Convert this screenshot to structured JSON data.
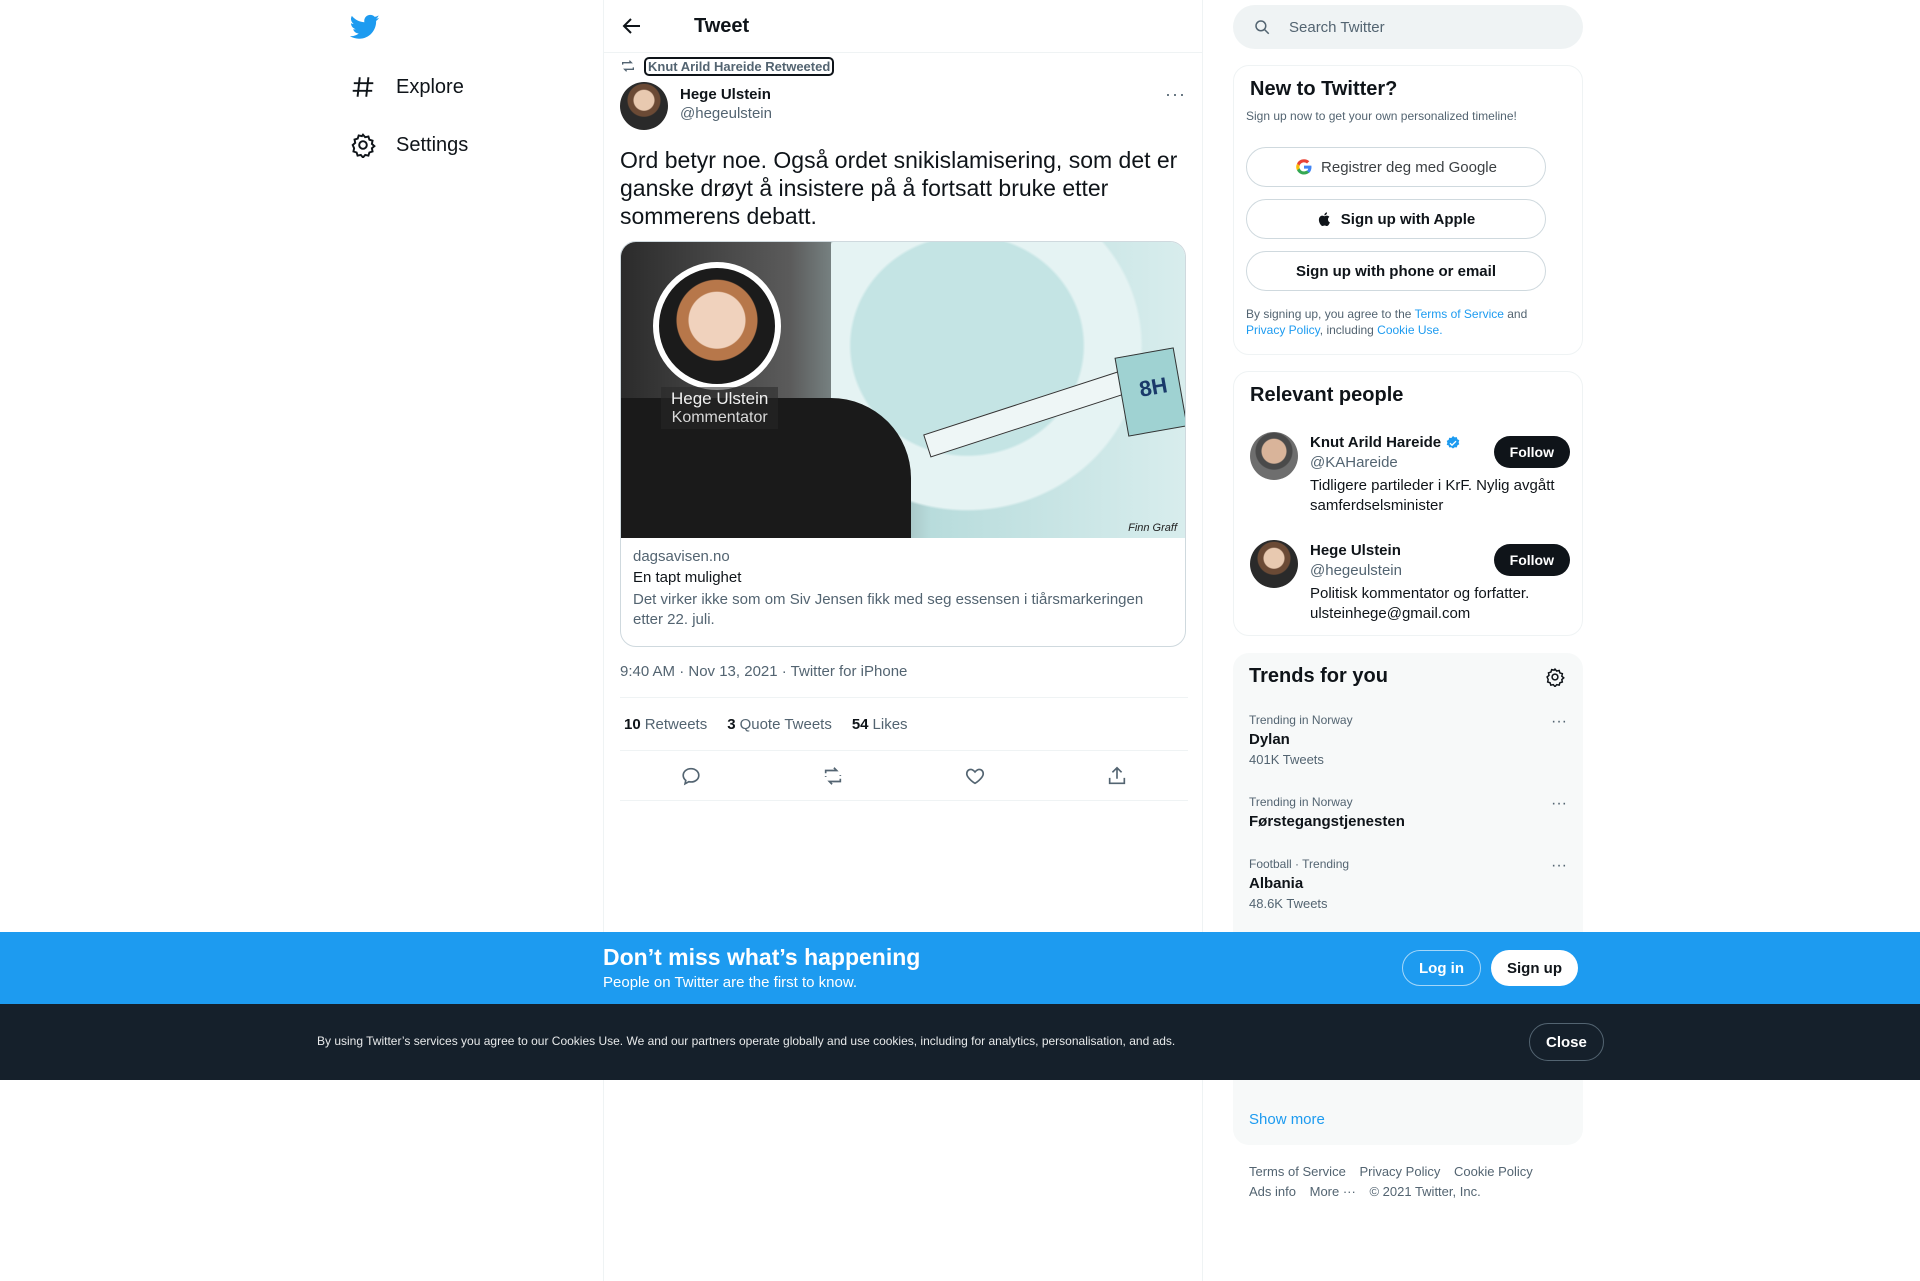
{
  "nav": {
    "explore_label": "Explore",
    "settings_label": "Settings"
  },
  "tweet_header": {
    "title": "Tweet"
  },
  "tweet": {
    "retweeted_by": "Knut Arild Hareide Retweeted",
    "author_name": "Hege Ulstein",
    "author_handle": "@hegeulstein",
    "more": "···",
    "text": "Ord betyr noe. Også ordet snikislamisering, som det er ganske drøyt å insistere på å fortsatt bruke etter sommerens debatt.",
    "card": {
      "image_caption_name": "Hege Ulstein",
      "image_caption_role": "Kommentator",
      "image_sleeve_text": "8H",
      "image_signature": "Finn Graff",
      "domain": "dagsavisen.no",
      "title": "En tapt mulighet",
      "description": "Det virker ikke som om Siv Jensen fikk med seg essensen i tiårsmarkeringen etter 22. juli."
    },
    "timestamp": "9:40 AM · Nov 13, 2021 · Twitter for iPhone",
    "stats": {
      "retweets_count": "10",
      "retweets_label": "Retweets",
      "quotes_count": "3",
      "quotes_label": "Quote Tweets",
      "likes_count": "54",
      "likes_label": "Likes"
    }
  },
  "search": {
    "placeholder": "Search Twitter"
  },
  "new_to_twitter": {
    "title": "New to Twitter?",
    "subtitle": "Sign up now to get your own personalized timeline!",
    "google_label": "Registrer deg med Google",
    "apple_label": "Sign up with Apple",
    "phone_label": "Sign up with phone or email",
    "legal_prefix": "By signing up, you agree to the ",
    "terms": "Terms of Service",
    "and": " and ",
    "privacy": "Privacy Policy",
    "including": ", including ",
    "cookie_use": "Cookie Use."
  },
  "relevant_people": {
    "title": "Relevant people",
    "people": [
      {
        "name": "Knut Arild Hareide",
        "handle": "@KAHareide",
        "bio": "Tidligere partileder i KrF. Nylig avgått samferdselsminister",
        "follow": "Follow",
        "verified": true
      },
      {
        "name": "Hege Ulstein",
        "handle": "@hegeulstein",
        "bio": "Politisk kommentator og forfatter. ulsteinhege@gmail.com",
        "follow": "Follow",
        "verified": false
      }
    ]
  },
  "trends": {
    "title": "Trends for you",
    "items": [
      {
        "context": "Trending in Norway",
        "name": "Dylan",
        "count": "401K Tweets"
      },
      {
        "context": "Trending in Norway",
        "name": "Førstegangstjenesten",
        "count": ""
      },
      {
        "context": "Football · Trending",
        "name": "Albania",
        "count": "48.6K Tweets"
      }
    ],
    "show_more": "Show more"
  },
  "footer": {
    "terms": "Terms of Service",
    "privacy": "Privacy Policy",
    "cookie": "Cookie Policy",
    "ads": "Ads info",
    "more": "More ···",
    "copyright": "© 2021 Twitter, Inc."
  },
  "promo": {
    "title": "Don’t miss what’s happening",
    "subtitle": "People on Twitter are the first to know.",
    "login": "Log in",
    "signup": "Sign up"
  },
  "cookie_bar": {
    "text": "By using Twitter’s services you agree to our Cookies Use. We and our partners operate globally and use cookies, including for analytics, personalisation, and ads.",
    "close": "Close"
  },
  "colors": {
    "accent": "#1d9bf0",
    "text": "#0f1419",
    "muted": "#536471",
    "cookie_bg": "#15202b"
  }
}
